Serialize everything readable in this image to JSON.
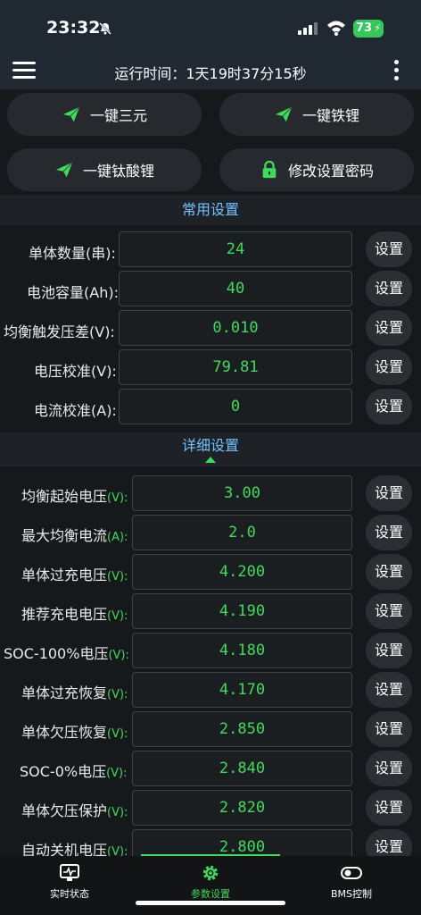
{
  "status_bar": {
    "time": "23:32",
    "battery": "73"
  },
  "header": {
    "runtime": "运行时间：1天19时37分15秒"
  },
  "presets": [
    {
      "label": "一键三元",
      "icon": "paper-plane-icon"
    },
    {
      "label": "一键铁锂",
      "icon": "paper-plane-icon"
    },
    {
      "label": "一键钛酸锂",
      "icon": "paper-plane-icon"
    },
    {
      "label": "修改设置密码",
      "icon": "lock-icon"
    }
  ],
  "common": {
    "title": "常用设置",
    "rows": [
      {
        "label": "单体数量(串):",
        "value": "24",
        "button": "设置"
      },
      {
        "label": "电池容量(Ah):",
        "value": "40",
        "button": "设置"
      },
      {
        "label": "均衡触发压差(V):",
        "value": "0.010",
        "button": "设置"
      },
      {
        "label": "电压校准(V):",
        "value": "79.81",
        "button": "设置"
      },
      {
        "label": "电流校准(A):",
        "value": "0",
        "button": "设置"
      }
    ]
  },
  "detail": {
    "title": "详细设置",
    "rows": [
      {
        "label": "均衡起始电压",
        "unit": "(V):",
        "value": "3.00",
        "button": "设置"
      },
      {
        "label": "最大均衡电流",
        "unit": "(A):",
        "value": "2.0",
        "button": "设置"
      },
      {
        "label": "单体过充电压",
        "unit": "(V):",
        "value": "4.200",
        "button": "设置"
      },
      {
        "label": "推荐充电电压",
        "unit": "(V):",
        "value": "4.190",
        "button": "设置"
      },
      {
        "label": "SOC-100%电压",
        "unit": "(V):",
        "value": "4.180",
        "button": "设置"
      },
      {
        "label": "单体过充恢复",
        "unit": "(V):",
        "value": "4.170",
        "button": "设置"
      },
      {
        "label": "单体欠压恢复",
        "unit": "(V):",
        "value": "2.850",
        "button": "设置"
      },
      {
        "label": "SOC-0%电压",
        "unit": "(V):",
        "value": "2.840",
        "button": "设置"
      },
      {
        "label": "单体欠压保护",
        "unit": "(V):",
        "value": "2.820",
        "button": "设置"
      },
      {
        "label": "自动关机电压",
        "unit": "(V):",
        "value": "2.800",
        "button": "设置"
      }
    ]
  },
  "nav": [
    {
      "label": "实时状态",
      "icon": "monitor-icon"
    },
    {
      "label": "参数设置",
      "icon": "gear-icon"
    },
    {
      "label": "BMS控制",
      "icon": "toggle-icon"
    }
  ],
  "colors": {
    "accent": "#3ddc5a",
    "section_title": "#6fc3ff"
  }
}
